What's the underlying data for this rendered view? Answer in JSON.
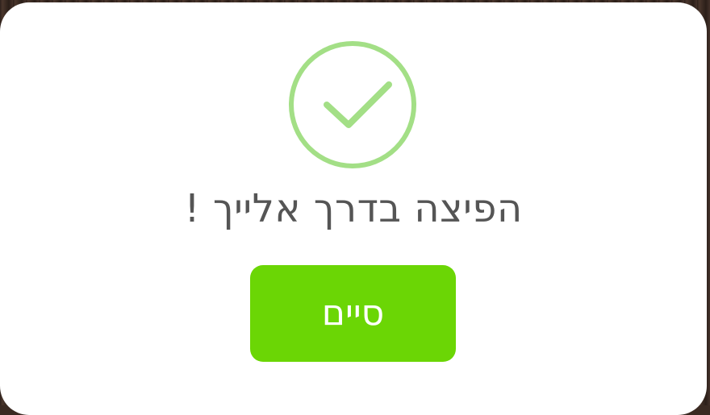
{
  "dialog": {
    "message": "הפיצה בדרך אלייך !",
    "done_label": "סיים",
    "icon": "check-circle-icon"
  },
  "colors": {
    "accent": "#6bd605",
    "check": "#a3df86",
    "message_text": "#555555",
    "background": "#3a2a22"
  }
}
